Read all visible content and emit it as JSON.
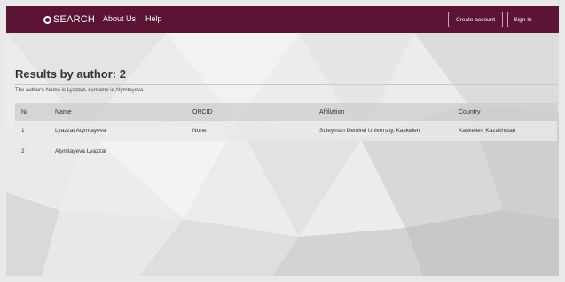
{
  "navbar": {
    "brand": "SEARCH",
    "links": [
      "About Us",
      "Help"
    ],
    "create_account": "Create account",
    "sign_in": "Sign In"
  },
  "results": {
    "title": "Results by author: 2",
    "subtitle": "The author's Name is Lyazzat, surname is Atymtayeva",
    "columns": [
      "№",
      "Name",
      "ORCID",
      "Affiliation",
      "Country"
    ],
    "rows": [
      [
        "1",
        "Lyazzat Atymtayeva",
        "None",
        "Suleyman Demirel University, Kaskelen",
        "Kaskelen, Kazakhstan"
      ],
      [
        "2",
        "Atymtayeva Lyazzat",
        "",
        "",
        ""
      ]
    ]
  },
  "colors": {
    "navbar": "#5b1433",
    "background": "#ececec"
  },
  "icons": {
    "brand": "search-logo-icon"
  }
}
